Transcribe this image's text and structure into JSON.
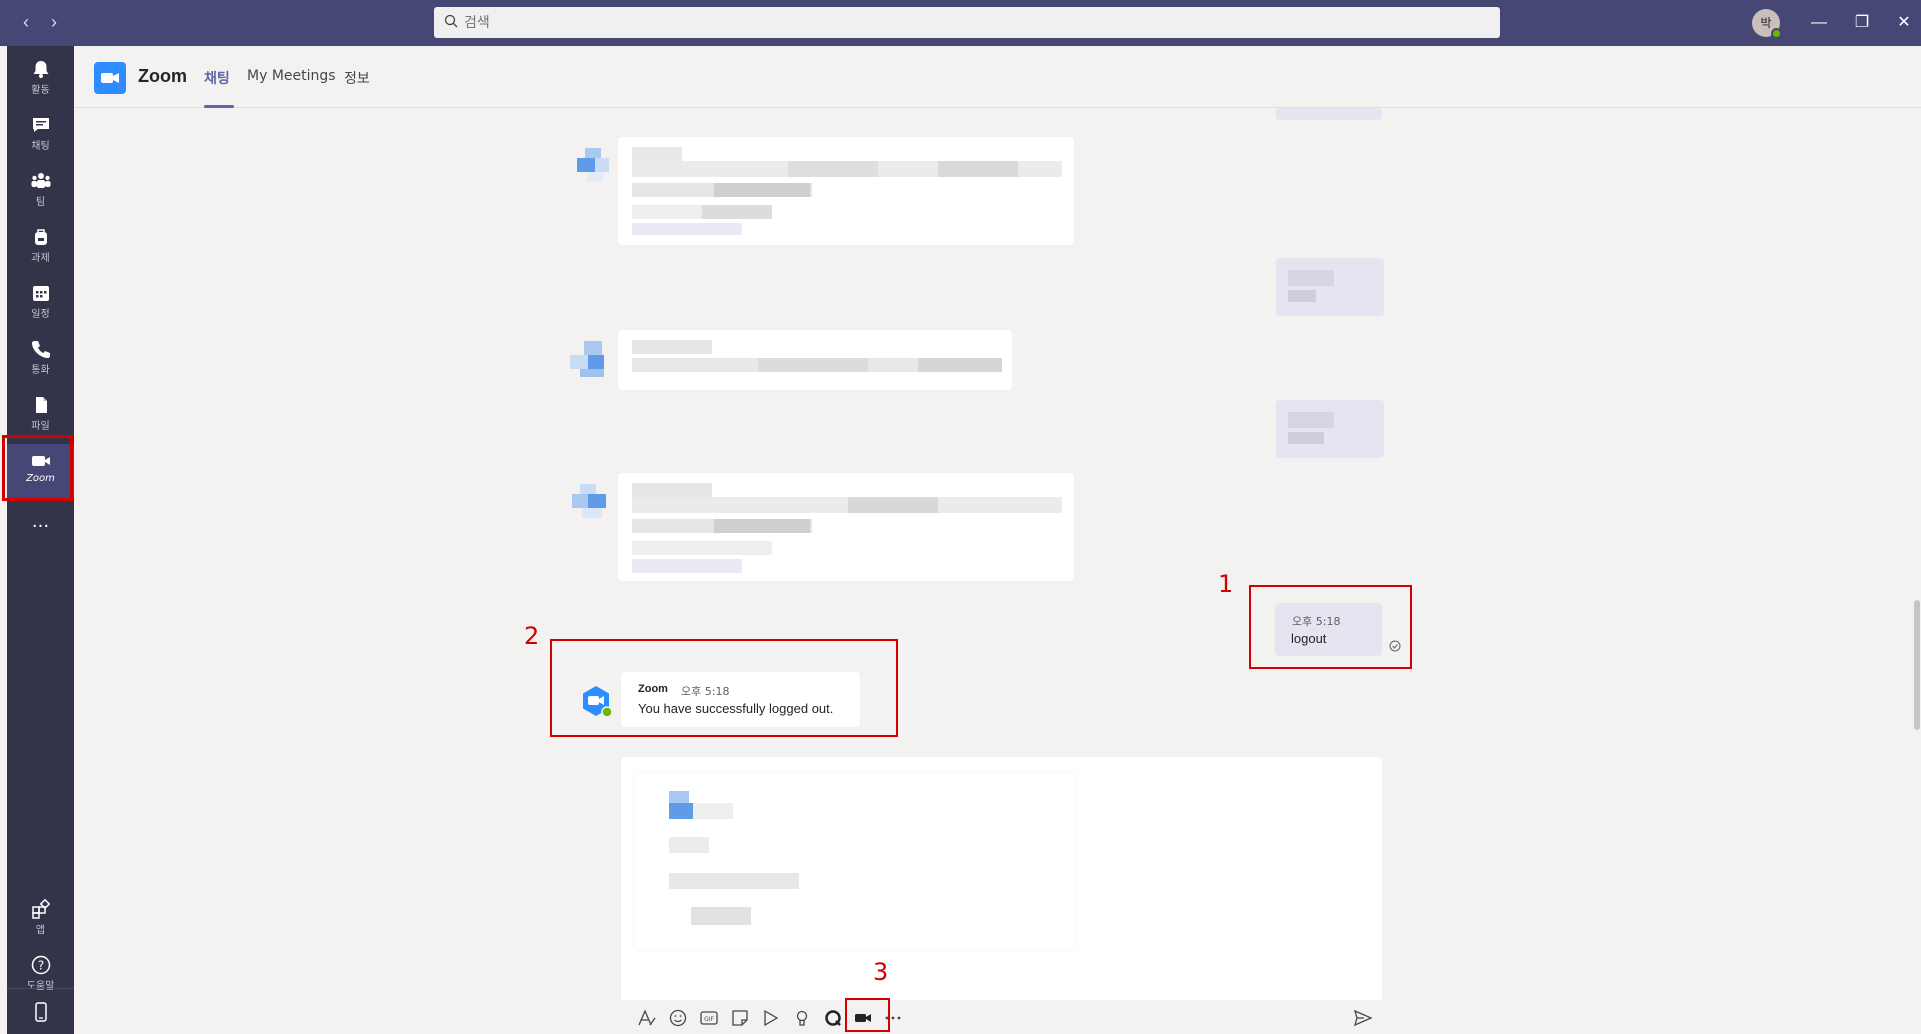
{
  "titlebar": {
    "search_placeholder": "검색",
    "avatar_initial": "박",
    "back_glyph": "‹",
    "forward_glyph": "›",
    "minimize_glyph": "—",
    "restore_glyph": "❐",
    "close_glyph": "✕"
  },
  "rail": {
    "items": [
      {
        "label": "활동",
        "icon": "bell-icon"
      },
      {
        "label": "채팅",
        "icon": "chat-icon"
      },
      {
        "label": "팀",
        "icon": "teams-icon"
      },
      {
        "label": "과제",
        "icon": "backpack-icon"
      },
      {
        "label": "일정",
        "icon": "calendar-icon"
      },
      {
        "label": "통화",
        "icon": "phone-icon"
      },
      {
        "label": "파일",
        "icon": "file-icon"
      },
      {
        "label": "Zoom",
        "icon": "zoom-camera-icon"
      }
    ],
    "more_label": "···",
    "apps_label": "앱",
    "help_label": "도움말"
  },
  "header": {
    "app_name": "Zoom",
    "tabs": [
      {
        "label": "채팅",
        "active": true
      },
      {
        "label": "My Meetings",
        "active": false
      },
      {
        "label": "정보",
        "active": false
      }
    ]
  },
  "messages": {
    "mine": {
      "time": "오후 5:18",
      "text": "logout"
    },
    "bot": {
      "sender": "Zoom",
      "time": "오후 5:18",
      "text": "You have successfully logged out."
    }
  },
  "annotations": [
    "1",
    "2",
    "3"
  ],
  "colors": {
    "titlebar": "#464775",
    "rail": "#33344a",
    "accent": "#6264a7",
    "zoom_blue": "#2d8cff",
    "annotation_red": "#d40000"
  }
}
